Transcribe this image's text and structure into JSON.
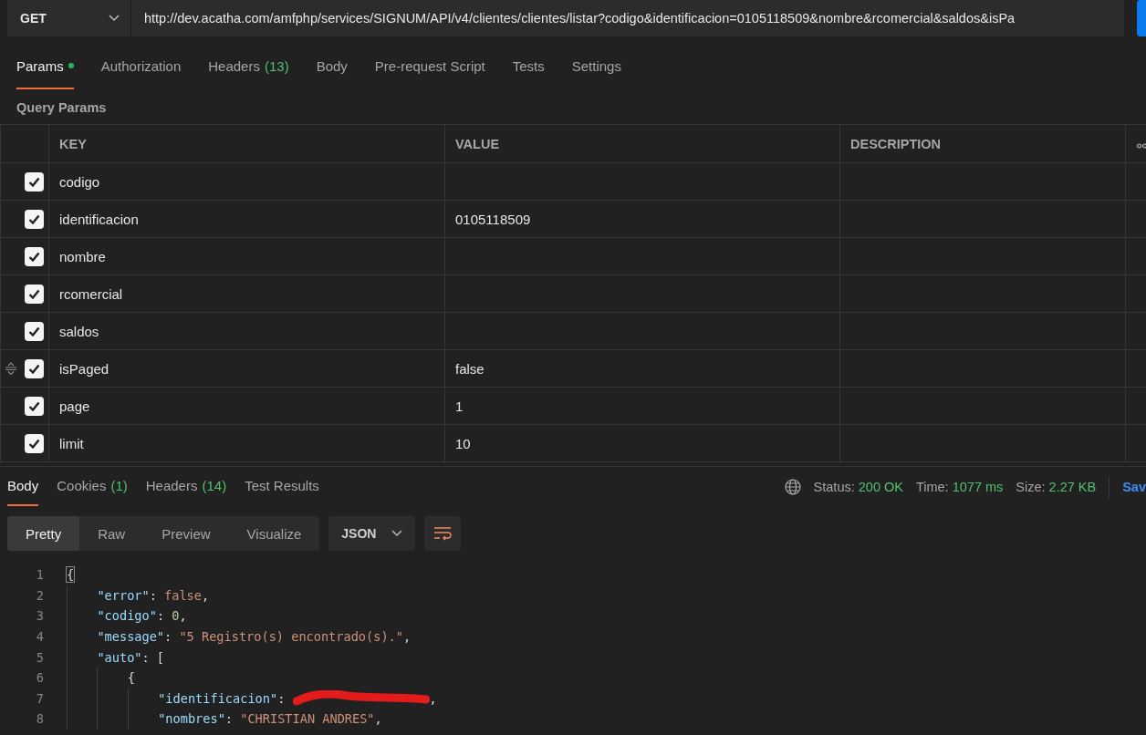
{
  "request": {
    "method": "GET",
    "url": "http://dev.acatha.com/amfphp/services/SIGNUM/API/v4/clientes/clientes/listar?codigo&identificacion=0105118509&nombre&rcomercial&saldos&isPa"
  },
  "request_tabs": [
    {
      "label": "Params",
      "dot": true,
      "selected": true
    },
    {
      "label": "Authorization",
      "dot": false,
      "selected": false
    },
    {
      "label": "Headers",
      "count": "(13)",
      "dot": false,
      "selected": false
    },
    {
      "label": "Body",
      "dot": false,
      "selected": false
    },
    {
      "label": "Pre-request Script",
      "dot": false,
      "selected": false
    },
    {
      "label": "Tests",
      "dot": false,
      "selected": false
    },
    {
      "label": "Settings",
      "dot": false,
      "selected": false
    }
  ],
  "section_title": "Query Params",
  "params_table": {
    "columns": [
      "KEY",
      "VALUE",
      "DESCRIPTION"
    ],
    "rows": [
      {
        "key": "codigo",
        "value": "",
        "checked": true,
        "hovered": false
      },
      {
        "key": "identificacion",
        "value": "0105118509",
        "checked": true,
        "hovered": false
      },
      {
        "key": "nombre",
        "value": "",
        "checked": true,
        "hovered": false
      },
      {
        "key": "rcomercial",
        "value": "",
        "checked": true,
        "hovered": false
      },
      {
        "key": "saldos",
        "value": "",
        "checked": true,
        "hovered": false
      },
      {
        "key": "isPaged",
        "value": "false",
        "checked": true,
        "hovered": true
      },
      {
        "key": "page",
        "value": "1",
        "checked": true,
        "hovered": false
      },
      {
        "key": "limit",
        "value": "10",
        "checked": true,
        "hovered": false
      }
    ]
  },
  "response_tabs": [
    {
      "label": "Body",
      "selected": true
    },
    {
      "label": "Cookies",
      "count": "(1)",
      "selected": false
    },
    {
      "label": "Headers",
      "count": "(14)",
      "selected": false
    },
    {
      "label": "Test Results",
      "selected": false
    }
  ],
  "response_stats": [
    {
      "label": "Status:",
      "value": "200 OK"
    },
    {
      "label": "Time:",
      "value": "1077 ms"
    },
    {
      "label": "Size:",
      "value": "2.27 KB"
    }
  ],
  "save_link": "Sav",
  "view_modes": [
    {
      "label": "Pretty",
      "selected": true
    },
    {
      "label": "Raw",
      "selected": false
    },
    {
      "label": "Preview",
      "selected": false
    },
    {
      "label": "Visualize",
      "selected": false
    }
  ],
  "format": "JSON",
  "code": [
    {
      "number": "1",
      "tokens": [
        {
          "kind": "punct",
          "text": "{",
          "matched": true
        }
      ],
      "children": [
        {
          "number": "2",
          "tokens": [
            {
              "kind": "key",
              "text": "\"error\""
            },
            {
              "kind": "punct",
              "text": ": "
            },
            {
              "kind": "bool",
              "text": "false"
            },
            {
              "kind": "punct",
              "text": ","
            }
          ]
        },
        {
          "number": "3",
          "tokens": [
            {
              "kind": "key",
              "text": "\"codigo\""
            },
            {
              "kind": "punct",
              "text": ": "
            },
            {
              "kind": "number",
              "text": "0"
            },
            {
              "kind": "punct",
              "text": ","
            }
          ]
        },
        {
          "number": "4",
          "tokens": [
            {
              "kind": "key",
              "text": "\"message\""
            },
            {
              "kind": "punct",
              "text": ": "
            },
            {
              "kind": "string",
              "text": "\"5 Registro(s) encontrado(s).\""
            },
            {
              "kind": "punct",
              "text": ","
            }
          ]
        },
        {
          "number": "5",
          "tokens": [
            {
              "kind": "key",
              "text": "\"auto\""
            },
            {
              "kind": "punct",
              "text": ": ["
            }
          ],
          "children": [
            {
              "number": "6",
              "tokens": [
                {
                  "kind": "punct",
                  "text": "{"
                }
              ],
              "children": [
                {
                  "number": "7",
                  "tokens": [
                    {
                      "kind": "key",
                      "text": "\"identificacion\""
                    },
                    {
                      "kind": "punct",
                      "text": ": "
                    },
                    {
                      "kind": "redacted"
                    },
                    {
                      "kind": "punct",
                      "text": ","
                    }
                  ]
                },
                {
                  "number": "8",
                  "tokens": [
                    {
                      "kind": "key",
                      "text": "\"nombres\""
                    },
                    {
                      "kind": "punct",
                      "text": ": "
                    },
                    {
                      "kind": "string",
                      "text": "\"CHRISTIAN ANDRES\""
                    },
                    {
                      "kind": "punct",
                      "text": ","
                    }
                  ]
                }
              ]
            }
          ]
        }
      ]
    }
  ]
}
